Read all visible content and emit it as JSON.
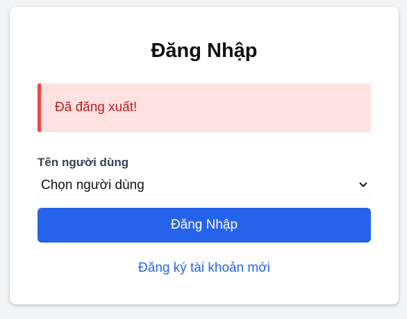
{
  "login": {
    "title": "Đăng Nhập",
    "alert_message": "Đã đăng xuất!",
    "username_label": "Tên người dùng",
    "username_select_value": "Chọn người dùng",
    "submit_label": "Đăng Nhập",
    "register_link": "Đăng ký tài khoản mới"
  },
  "colors": {
    "primary": "#2563eb",
    "alert_background": "#fee2e2",
    "alert_border": "#ef4444",
    "alert_text": "#b91c1c"
  },
  "icons": {
    "select": "chevron-down-icon"
  }
}
